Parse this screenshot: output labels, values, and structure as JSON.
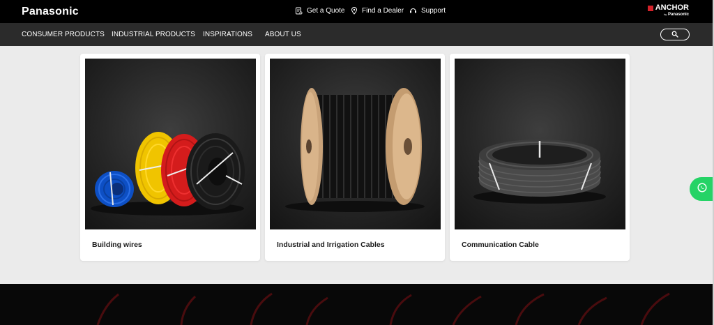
{
  "header": {
    "logo": "Panasonic",
    "utility_links": [
      {
        "label": "Get a Quote",
        "icon": "quote-icon"
      },
      {
        "label": "Find a Dealer",
        "icon": "location-pin-icon"
      },
      {
        "label": "Support",
        "icon": "support-icon"
      }
    ],
    "sub_brand": {
      "name": "ANCHOR",
      "by": "by",
      "parent": "Panasonic"
    }
  },
  "nav": {
    "items": [
      "CONSUMER PRODUCTS",
      "INDUSTRIAL PRODUCTS",
      "INSPIRATIONS",
      "ABOUT US"
    ],
    "search_icon": "search-icon"
  },
  "products": [
    {
      "title": "Building wires",
      "image": "building-wires-coils"
    },
    {
      "title": "Industrial and Irrigation Cables",
      "image": "cable-drum"
    },
    {
      "title": "Communication Cable",
      "image": "communication-cable-coil"
    }
  ],
  "floating": {
    "whatsapp_icon": "whatsapp-icon"
  },
  "colors": {
    "topbar": "#000000",
    "navbar": "#2b2b2b",
    "page_bg": "#ebebeb",
    "whatsapp": "#25d366",
    "footer": "#080808",
    "footer_accent": "#5a0d10"
  }
}
